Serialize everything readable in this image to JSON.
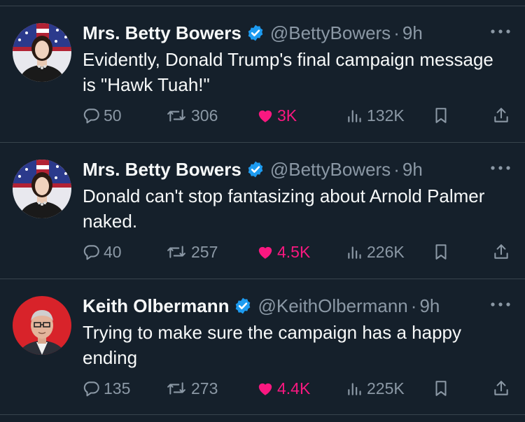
{
  "tweets": [
    {
      "name": "Mrs. Betty Bowers",
      "handle": "@BettyBowers",
      "separator": "·",
      "time": "9h",
      "text": "Evidently, Donald Trump's final campaign message is \"Hawk Tuah!\"",
      "replies": "50",
      "retweets": "306",
      "likes": "3K",
      "views": "132K",
      "avatar": "flag-portrait"
    },
    {
      "name": "Mrs. Betty Bowers",
      "handle": "@BettyBowers",
      "separator": "·",
      "time": "9h",
      "text": "Donald can't stop fantasizing about Arnold Palmer naked.",
      "replies": "40",
      "retweets": "257",
      "likes": "4.5K",
      "views": "226K",
      "avatar": "flag-portrait"
    },
    {
      "name": "Keith Olbermann",
      "handle": "@KeithOlbermann",
      "separator": "·",
      "time": "9h",
      "text": "Trying to make sure the campaign has a happy ending",
      "replies": "135",
      "retweets": "273",
      "likes": "4.4K",
      "views": "225K",
      "avatar": "red-portrait"
    }
  ],
  "icons": {
    "verified": "verified-badge-icon",
    "more": "more-icon",
    "reply": "reply-icon",
    "retweet": "retweet-icon",
    "like": "heart-icon",
    "views": "views-icon",
    "bookmark": "bookmark-icon",
    "share": "share-icon"
  },
  "colors": {
    "background": "#15202b",
    "text": "#f7f9f9",
    "muted": "#8b98a5",
    "like": "#f91880",
    "verified": "#1d9bf0",
    "divider": "#38444d"
  }
}
